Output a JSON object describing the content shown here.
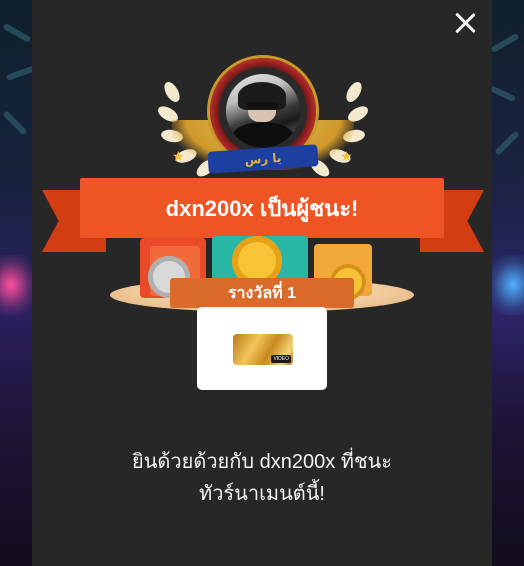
{
  "modal": {
    "close_icon": "close-icon",
    "winner_banner": "dxn200x เป็นผู้ชนะ!",
    "crest_text": "ﻳﺎ ﺭﺱ",
    "prize_rank_label": "รางวัลที่ 1",
    "prize_badge": "VIDEO",
    "congrats_line1": "ยินด้วยด้วยกับ dxn200x ที่ชนะ",
    "congrats_line2": "ทัวร์นาเมนต์นี้!"
  },
  "colors": {
    "modal_bg": "#272727",
    "banner": "#ef5424",
    "banner_tail": "#d23e12",
    "laurel": "#f3e9cf",
    "gold": "#e2a52a",
    "rank_label": "#d96a2a"
  }
}
